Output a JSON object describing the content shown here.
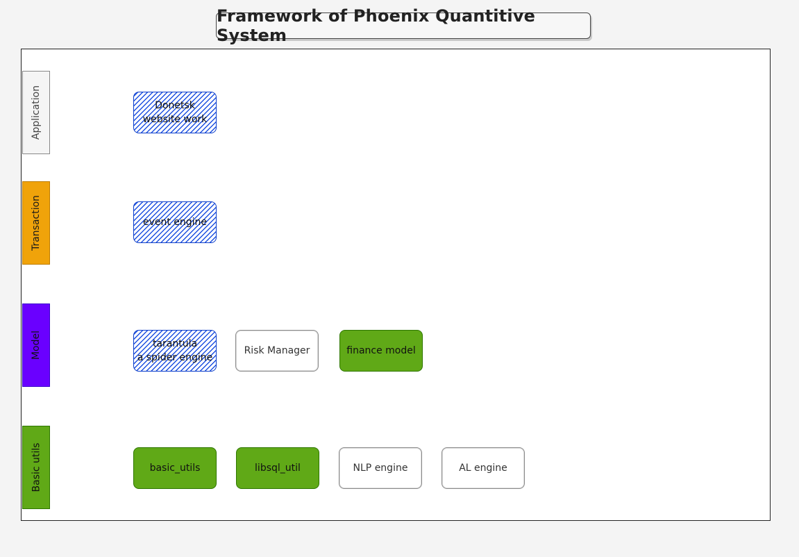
{
  "title": "Framework of Phoenix Quantitive System",
  "layers": {
    "application": "Application",
    "transaction": "Transaction",
    "model": "Model",
    "basic_utils": "Basic utils"
  },
  "nodes": {
    "donetsk": "Donetsk\nwebsite work",
    "event_engine": "event engine",
    "tarantula": "tarantula\na spider engine",
    "risk_manager": "Risk Manager",
    "finance_model": "finance model",
    "basic_utils": "basic_utils",
    "libsql_util": "libsql_util",
    "nlp_engine": "NLP engine",
    "al_engine": "AL engine"
  },
  "colors": {
    "hatch_blue": "#1c4fe0",
    "green": "#60a917",
    "orange": "#f0a30a",
    "purple": "#6a00ff"
  }
}
